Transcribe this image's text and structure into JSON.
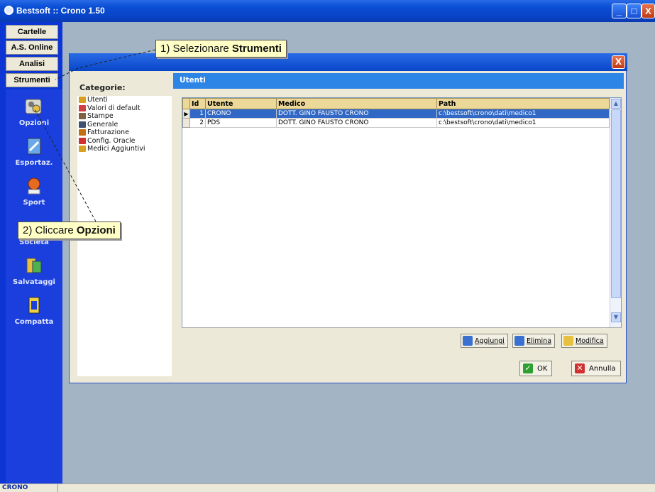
{
  "window": {
    "title": "Bestsoft :: Crono 1.50",
    "controls": {
      "minimize": "_",
      "maximize": "□",
      "close": "X"
    }
  },
  "sidebar": {
    "tabs": [
      "Cartelle",
      "A.S. Online",
      "Analisi",
      "Strumenti"
    ],
    "tools": [
      {
        "label": "Opzioni",
        "icon": "options-icon"
      },
      {
        "label": "Esportaz.",
        "icon": "export-icon"
      },
      {
        "label": "Sport",
        "icon": "sport-icon"
      },
      {
        "label": "Società",
        "icon": "society-icon"
      },
      {
        "label": "Salvataggi",
        "icon": "backup-icon"
      },
      {
        "label": "Compatta",
        "icon": "compact-icon"
      }
    ]
  },
  "statusbar": {
    "left": "CRONO"
  },
  "dialog": {
    "close": "X",
    "categories_title": "Categorie:",
    "categories": [
      {
        "label": "Utenti",
        "icon": "user-icon",
        "color": "#d9a020"
      },
      {
        "label": "Valori di default",
        "icon": "defaults-icon",
        "color": "#d04040"
      },
      {
        "label": "Stampe",
        "icon": "printer-icon",
        "color": "#806040"
      },
      {
        "label": "Generale",
        "icon": "general-icon",
        "color": "#405070"
      },
      {
        "label": "Fatturazione",
        "icon": "invoice-icon",
        "color": "#c07010"
      },
      {
        "label": "Config. Oracle",
        "icon": "oracle-icon",
        "color": "#d03030"
      },
      {
        "label": "Medici Aggiuntivi",
        "icon": "doctors-icon",
        "color": "#d9a020"
      }
    ],
    "panel_title": "Utenti",
    "grid": {
      "columns": [
        "Id",
        "Utente",
        "Medico",
        "Path"
      ],
      "rows": [
        {
          "id": "1",
          "utente": "CRONO",
          "medico": "DOTT. GINO FAUSTO CRONO",
          "path": "c:\\bestsoft\\crono\\dati\\medico1",
          "selected": true
        },
        {
          "id": "2",
          "utente": "PDS",
          "medico": "DOTT. GINO FAUSTO CRONO",
          "path": "c:\\bestsoft\\crono\\dati\\medico1",
          "selected": false
        }
      ]
    },
    "grid_buttons": {
      "add": "Aggiungi",
      "delete": "Elimina",
      "edit": "Modifica"
    },
    "ok": "OK",
    "cancel": "Annulla"
  },
  "callouts": {
    "step1_prefix": "1) Selezionare ",
    "step1_bold": "Strumenti",
    "step2_prefix": "2) Cliccare ",
    "step2_bold": "Opzioni"
  },
  "colors": {
    "accent": "#2d86e6",
    "selection": "#3168c6",
    "sidebar": "#0d35d4",
    "callout": "#ffffc6"
  }
}
